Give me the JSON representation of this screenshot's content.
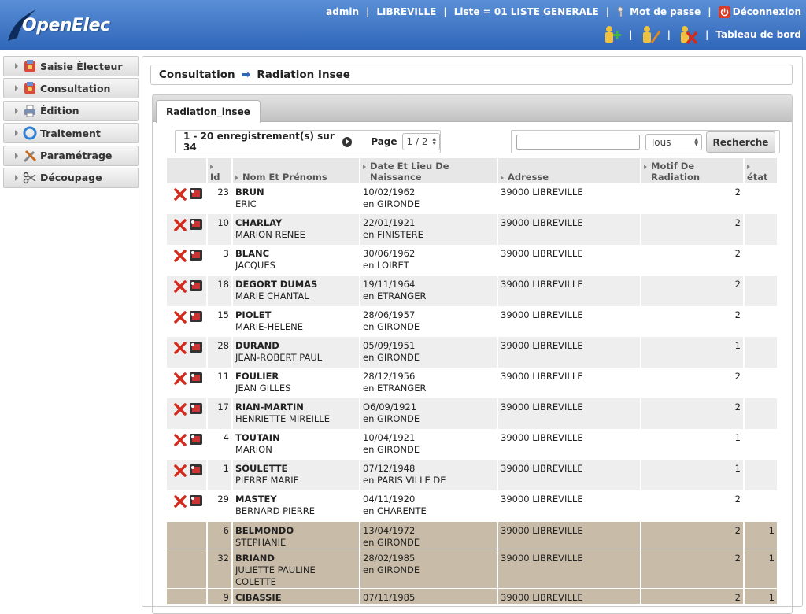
{
  "app": {
    "logo_text": "OpenElec"
  },
  "topbar": {
    "user": "admin",
    "commune": "LIBREVILLE",
    "liste": "Liste = 01 LISTE GENERALE",
    "password_link": "Mot de passe",
    "logout_link": "Déconnexion",
    "dashboard_link": "Tableau de bord"
  },
  "sidebar": {
    "items": [
      {
        "label": "Saisie Électeur",
        "icon": "voter-entry-icon"
      },
      {
        "label": "Consultation",
        "icon": "consultation-icon"
      },
      {
        "label": "Édition",
        "icon": "printer-icon"
      },
      {
        "label": "Traitement",
        "icon": "processing-icon"
      },
      {
        "label": "Paramétrage",
        "icon": "settings-tools-icon"
      },
      {
        "label": "Découpage",
        "icon": "scissors-icon"
      }
    ]
  },
  "breadcrumb": {
    "parent": "Consultation",
    "current": "Radiation Insee"
  },
  "tab": {
    "label": "Radiation_insee"
  },
  "pager": {
    "summary": "1 - 20 enregistrement(s) sur 34",
    "page_label": "Page",
    "page_value": "1 / 2"
  },
  "search": {
    "input_value": "",
    "filter_value": "Tous",
    "button_label": "Recherche"
  },
  "table": {
    "headers": {
      "id": "Id",
      "nom": "Nom Et Prénoms",
      "date_line1": "Date Et Lieu De",
      "date_line2": "Naissance",
      "adresse": "Adresse",
      "motif_line1": "Motif De",
      "motif_line2": "Radiation",
      "etat": "état"
    },
    "rows": [
      {
        "id": "23",
        "nom": "BRUN",
        "prenoms": "ERIC",
        "date": "10/02/1962",
        "lieu": "en GIRONDE",
        "adresse": "39000 LIBREVILLE",
        "motif": "2",
        "etat": "",
        "actions": true
      },
      {
        "id": "10",
        "nom": "CHARLAY",
        "prenoms": "MARION RENEE",
        "date": "22/01/1921",
        "lieu": "en FINISTERE",
        "adresse": "39000 LIBREVILLE",
        "motif": "2",
        "etat": "",
        "actions": true
      },
      {
        "id": "3",
        "nom": "BLANC",
        "prenoms": "JACQUES",
        "date": "30/06/1962",
        "lieu": "en LOIRET",
        "adresse": "39000 LIBREVILLE",
        "motif": "2",
        "etat": "",
        "actions": true
      },
      {
        "id": "18",
        "nom": "DEGORT DUMAS",
        "prenoms": "MARIE CHANTAL",
        "date": "19/11/1964",
        "lieu": "en ETRANGER",
        "adresse": "39000 LIBREVILLE",
        "motif": "2",
        "etat": "",
        "actions": true
      },
      {
        "id": "15",
        "nom": "PIOLET",
        "prenoms": "MARIE-HELENE",
        "date": "28/06/1957",
        "lieu": "en GIRONDE",
        "adresse": "39000 LIBREVILLE",
        "motif": "2",
        "etat": "",
        "actions": true
      },
      {
        "id": "28",
        "nom": "DURAND",
        "prenoms": "JEAN-ROBERT PAUL",
        "date": "05/09/1951",
        "lieu": "en GIRONDE",
        "adresse": "39000 LIBREVILLE",
        "motif": "1",
        "etat": "",
        "actions": true
      },
      {
        "id": "11",
        "nom": "FOULIER",
        "prenoms": "JEAN GILLES",
        "date": "28/12/1956",
        "lieu": "en ETRANGER",
        "adresse": "39000 LIBREVILLE",
        "motif": "2",
        "etat": "",
        "actions": true
      },
      {
        "id": "17",
        "nom": "RIAN-MARTIN",
        "prenoms": "HENRIETTE MIREILLE",
        "date": "O6/09/1921",
        "lieu": "en GIRONDE",
        "adresse": "39000 LIBREVILLE",
        "motif": "2",
        "etat": "",
        "actions": true
      },
      {
        "id": "4",
        "nom": "TOUTAIN",
        "prenoms": "MARION",
        "date": "10/04/1921",
        "lieu": "en GIRONDE",
        "adresse": "39000 LIBREVILLE",
        "motif": "1",
        "etat": "",
        "actions": true
      },
      {
        "id": "1",
        "nom": "SOULETTE",
        "prenoms": "PIERRE MARIE",
        "date": "07/12/1948",
        "lieu": "en PARIS VILLE DE",
        "adresse": "39000 LIBREVILLE",
        "motif": "1",
        "etat": "",
        "actions": true
      },
      {
        "id": "29",
        "nom": "MASTEY",
        "prenoms": "BERNARD PIERRE",
        "date": "04/11/1920",
        "lieu": "en CHARENTE",
        "adresse": "39000 LIBREVILLE",
        "motif": "2",
        "etat": "",
        "actions": true
      },
      {
        "id": "6",
        "nom": "BELMONDO",
        "prenoms": "STEPHANIE",
        "date": "13/04/1972",
        "lieu": "en GIRONDE",
        "adresse": "39000 LIBREVILLE",
        "motif": "2",
        "etat": "1",
        "actions": false
      },
      {
        "id": "32",
        "nom": "BRIAND",
        "prenoms": "JULIETTE PAULINE COLETTE",
        "date": "28/02/1985",
        "lieu": "en GIRONDE",
        "adresse": "39000 LIBREVILLE",
        "motif": "2",
        "etat": "1",
        "actions": false
      },
      {
        "id": "9",
        "nom": "CIBASSIE",
        "prenoms": "",
        "date": "07/11/1985",
        "lieu": "",
        "adresse": "39000 LIBREVILLE",
        "motif": "2",
        "etat": "1",
        "actions": false
      }
    ]
  },
  "colors": {
    "header_blue": "#2f66b8",
    "processed_row": "#c8bca8",
    "delete_red": "#d22b1e"
  }
}
